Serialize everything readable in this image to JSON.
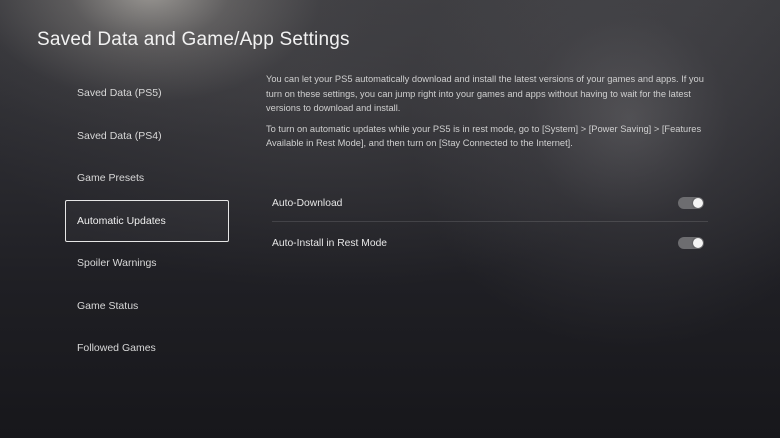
{
  "page": {
    "title": "Saved Data and Game/App Settings"
  },
  "sidebar": {
    "items": [
      {
        "label": "Saved Data (PS5)",
        "selected": false
      },
      {
        "label": "Saved Data (PS4)",
        "selected": false
      },
      {
        "label": "Game Presets",
        "selected": false
      },
      {
        "label": "Automatic Updates",
        "selected": true
      },
      {
        "label": "Spoiler Warnings",
        "selected": false
      },
      {
        "label": "Game Status",
        "selected": false
      },
      {
        "label": "Followed Games",
        "selected": false
      }
    ]
  },
  "content": {
    "paragraph_1": "You can let your PS5 automatically download and install the latest versions of your games and apps. If you turn on these settings, you can jump right into your games and apps without having to wait for the latest versions to download and install.",
    "paragraph_2": "To turn on automatic updates while your PS5 is in rest mode, go to [System] > [Power Saving] > [Features Available in Rest Mode], and then turn on [Stay Connected to the Internet].",
    "settings": [
      {
        "label": "Auto-Download",
        "enabled": true
      },
      {
        "label": "Auto-Install in Rest Mode",
        "enabled": true
      }
    ]
  },
  "colors": {
    "selected_border": "#e6e6e6",
    "toggle_track": "#6d6d70",
    "toggle_knob": "#f4f4f4"
  }
}
